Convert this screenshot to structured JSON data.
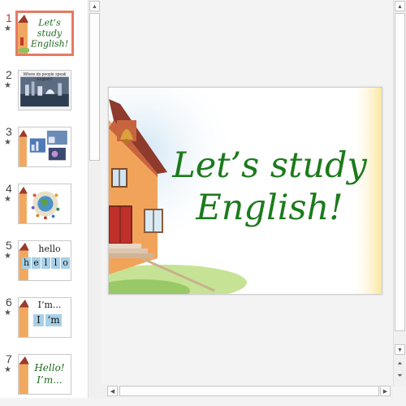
{
  "slides": [
    {
      "number": "1",
      "kind": "title",
      "text": "Let’s study English!",
      "active": true
    },
    {
      "number": "2",
      "kind": "photo",
      "caption": "Where do people speak English?"
    },
    {
      "number": "3",
      "kind": "photos"
    },
    {
      "number": "4",
      "kind": "globe"
    },
    {
      "number": "5",
      "kind": "word",
      "word": "hello",
      "letters": [
        "h",
        "e",
        "l",
        "l",
        "o"
      ]
    },
    {
      "number": "6",
      "kind": "word",
      "word": "I’m...",
      "letters": [
        "I",
        "‘m"
      ]
    },
    {
      "number": "7",
      "kind": "phrase",
      "text": "Hello! I’m..."
    }
  ],
  "main_slide": {
    "title_line1": "Let’s study",
    "title_line2": "English!"
  },
  "colors": {
    "accent_active": "#e57b62",
    "title_green": "#1c7a1c",
    "letter_tile": "#a8d0e6"
  },
  "icons": {
    "animation": "star-icon",
    "scroll_up": "triangle-up-icon",
    "scroll_down": "triangle-down-icon",
    "prev_slide": "double-up-icon",
    "next_slide": "double-down-icon"
  }
}
